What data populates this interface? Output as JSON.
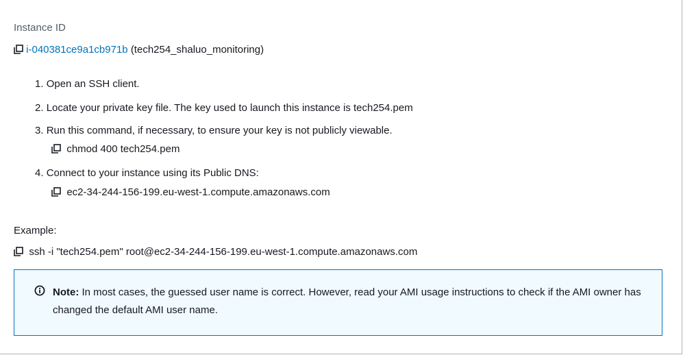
{
  "instance": {
    "label": "Instance ID",
    "id": "i-040381ce9a1cb971b",
    "name": "(tech254_shaluo_monitoring)"
  },
  "steps": [
    {
      "number": "1.",
      "text": "Open an SSH client."
    },
    {
      "number": "2.",
      "text": "Locate your private key file. The key used to launch this instance is tech254.pem"
    },
    {
      "number": "3.",
      "text": "Run this command, if necessary, to ensure your key is not publicly viewable.",
      "command": "chmod 400 tech254.pem"
    },
    {
      "number": "4.",
      "text": "Connect to your instance using its Public DNS:",
      "command": "ec2-34-244-156-199.eu-west-1.compute.amazonaws.com"
    }
  ],
  "example": {
    "label": "Example:",
    "command": "ssh -i \"tech254.pem\" root@ec2-34-244-156-199.eu-west-1.compute.amazonaws.com"
  },
  "note": {
    "title": "Note:",
    "text": "In most cases, the guessed user name is correct. However, read your AMI usage instructions to check if the AMI owner has changed the default AMI user name."
  },
  "colors": {
    "link": "#0073bb",
    "note_background": "#f1faff",
    "note_border": "#0073bb",
    "text": "#16191f",
    "muted": "#545b64"
  },
  "icons": [
    "copy-icon",
    "info-icon"
  ]
}
